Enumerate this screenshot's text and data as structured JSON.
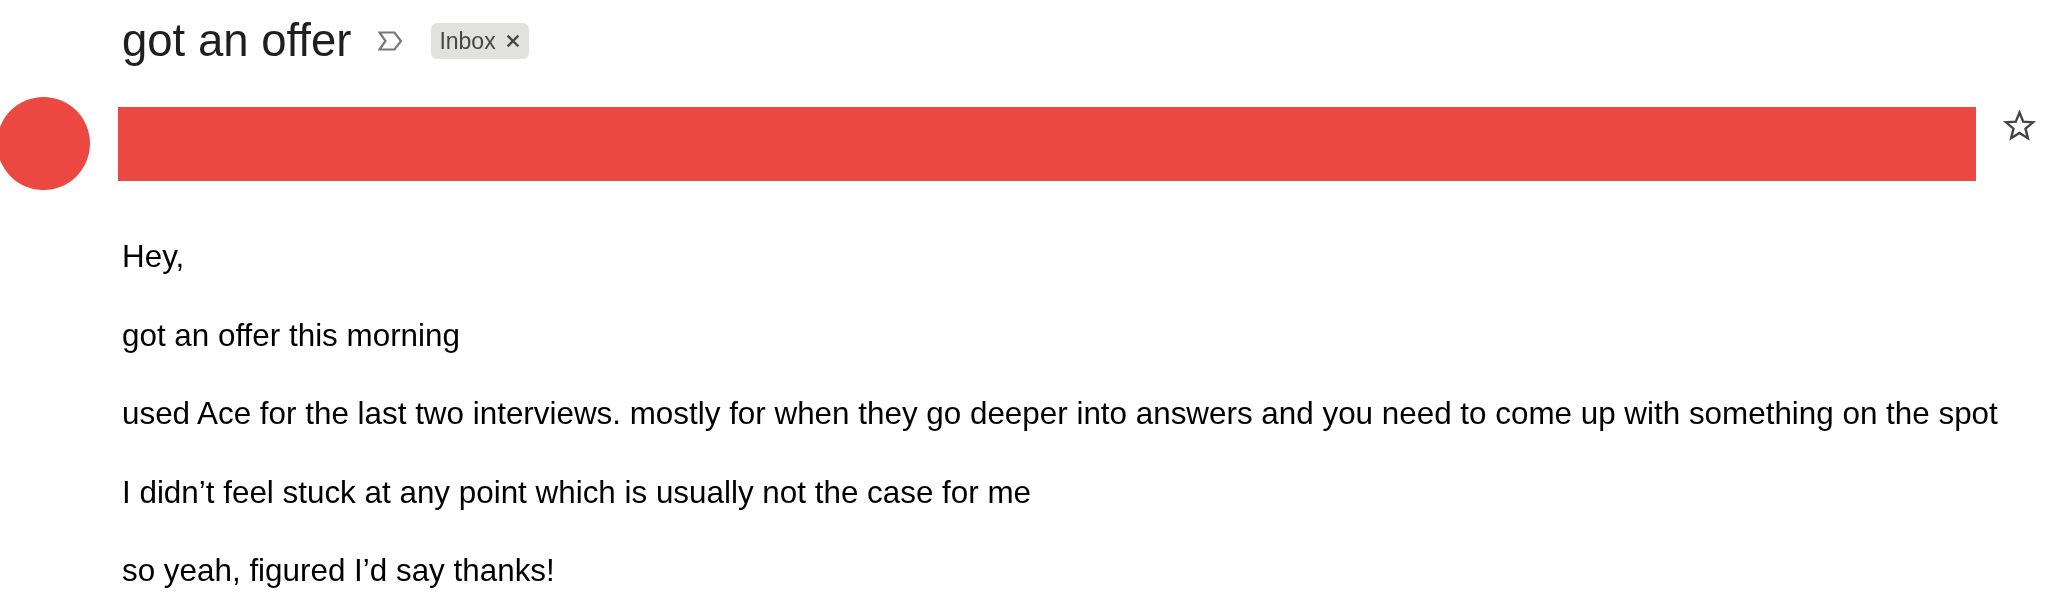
{
  "message": {
    "subject": "got an offer",
    "important": false,
    "starred": false,
    "labels": [
      {
        "text": "Inbox"
      }
    ],
    "body": [
      "Hey,",
      "got an offer this morning",
      "used Ace for the last two interviews. mostly for when they go deeper into answers and you need to come up with something on the spot",
      "I didn’t feel stuck at any point which is usually not the case for me",
      "so yeah, figured I’d say thanks!"
    ]
  }
}
